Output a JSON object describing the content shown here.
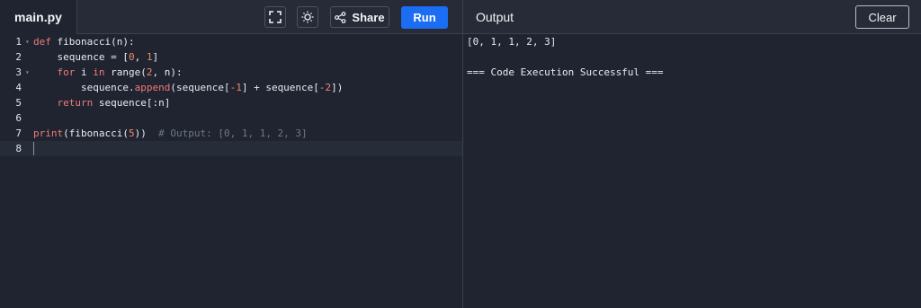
{
  "tab": {
    "filename": "main.py"
  },
  "toolbar": {
    "fullscreen_icon": "fullscreen-icon",
    "theme_icon": "sun-icon",
    "share_label": "Share",
    "run_label": "Run"
  },
  "output_panel": {
    "title": "Output",
    "clear_label": "Clear",
    "lines": [
      "[0, 1, 1, 2, 3]",
      "",
      "=== Code Execution Successful ==="
    ]
  },
  "editor": {
    "line_numbers": [
      "1",
      "2",
      "3",
      "4",
      "5",
      "6",
      "7",
      "8"
    ],
    "lines": [
      "def fibonacci(n):",
      "    sequence = [0, 1]",
      "    for i in range(2, n):",
      "        sequence.append(sequence[-1] + sequence[-2])",
      "    return sequence[:n]",
      "",
      "print(fibonacci(5))  # Output: [0, 1, 1, 2, 3]",
      ""
    ]
  },
  "colors": {
    "background": "#1f2430",
    "run_button": "#1b6ef3",
    "keyword": "#f07a7a",
    "number": "#f08a6b",
    "comment": "#6f7787"
  }
}
